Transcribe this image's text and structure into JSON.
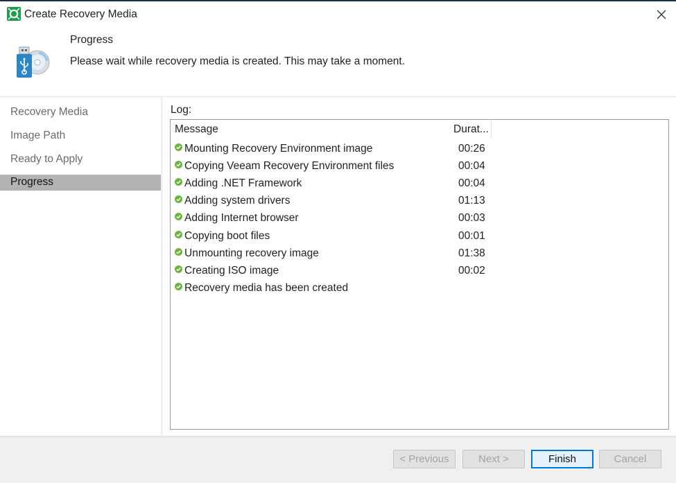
{
  "window": {
    "title": "Create Recovery Media"
  },
  "icons": {
    "app": "veeam-logo-icon",
    "header": "usb-disc-icon",
    "close": "close-icon",
    "check": "green-check-icon"
  },
  "colors": {
    "accent": "#0078d7",
    "check": "#6ab63c",
    "active_step_bg": "#b3b3b3"
  },
  "header": {
    "title": "Progress",
    "description": "Please wait while recovery media is created. This may take a moment."
  },
  "sidebar": {
    "steps": [
      {
        "label": "Recovery Media",
        "active": false
      },
      {
        "label": "Image Path",
        "active": false
      },
      {
        "label": "Ready to Apply",
        "active": false
      },
      {
        "label": "Progress",
        "active": true
      }
    ]
  },
  "log": {
    "label": "Log:",
    "columns": {
      "message": "Message",
      "duration": "Durat..."
    },
    "rows": [
      {
        "message": "Mounting Recovery Environment image",
        "duration": "00:26"
      },
      {
        "message": "Copying Veeam Recovery Environment files",
        "duration": "00:04"
      },
      {
        "message": "Adding .NET Framework",
        "duration": "00:04"
      },
      {
        "message": "Adding system drivers",
        "duration": "01:13"
      },
      {
        "message": "Adding Internet browser",
        "duration": "00:03"
      },
      {
        "message": "Copying boot files",
        "duration": "00:01"
      },
      {
        "message": "Unmounting recovery image",
        "duration": "01:38"
      },
      {
        "message": "Creating ISO image",
        "duration": "00:02"
      },
      {
        "message": "Recovery media has been created",
        "duration": ""
      }
    ]
  },
  "buttons": {
    "previous": "< Previous",
    "next": "Next >",
    "finish": "Finish",
    "cancel": "Cancel"
  }
}
